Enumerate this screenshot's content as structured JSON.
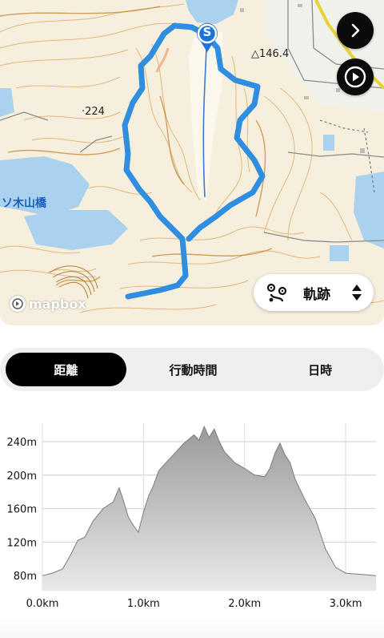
{
  "map": {
    "labels": {
      "elevation_point_1": "△146.4",
      "elevation_point_2": "·224",
      "place_name": "ソ木山橋"
    },
    "start_marker": "S",
    "attribution": "mapbox",
    "layer_selector": {
      "label": "軌跡"
    }
  },
  "controls": {
    "next": "chevron-right-icon",
    "play": "play-icon"
  },
  "tabs": [
    {
      "label": "距離",
      "selected": true
    },
    {
      "label": "行動時間",
      "selected": false
    },
    {
      "label": "日時",
      "selected": false
    }
  ],
  "chart_data": {
    "type": "area",
    "title": "",
    "xlabel": "",
    "ylabel": "",
    "x_ticks": [
      "0.0km",
      "1.0km",
      "2.0km",
      "3.0km"
    ],
    "y_ticks": [
      "80m",
      "120m",
      "160m",
      "200m",
      "240m"
    ],
    "xlim": [
      0,
      3.3
    ],
    "ylim": [
      62,
      262
    ],
    "series": [
      {
        "x": [
          0.0,
          0.1,
          0.2,
          0.28,
          0.35,
          0.42,
          0.5,
          0.6,
          0.7,
          0.76,
          0.8,
          0.85,
          0.9,
          0.95,
          1.0,
          1.05,
          1.1,
          1.15,
          1.2,
          1.3,
          1.4,
          1.5,
          1.55,
          1.6,
          1.65,
          1.7,
          1.75,
          1.8,
          1.9,
          2.0,
          2.1,
          2.2,
          2.25,
          2.3,
          2.35,
          2.4,
          2.45,
          2.5,
          2.6,
          2.7,
          2.8,
          2.9,
          3.0,
          3.1,
          3.2,
          3.3
        ],
        "y": [
          80,
          83,
          88,
          105,
          122,
          126,
          145,
          160,
          168,
          185,
          170,
          150,
          140,
          132,
          156,
          175,
          188,
          205,
          212,
          225,
          238,
          248,
          242,
          258,
          245,
          255,
          240,
          228,
          215,
          208,
          200,
          198,
          208,
          226,
          238,
          224,
          215,
          195,
          170,
          148,
          112,
          90,
          83,
          82,
          81,
          80
        ]
      }
    ],
    "grid": true,
    "colors": {
      "area_top": "#9a9a9a",
      "area_bottom": "#e9e9e9",
      "stroke": "#7c7c7c"
    }
  }
}
